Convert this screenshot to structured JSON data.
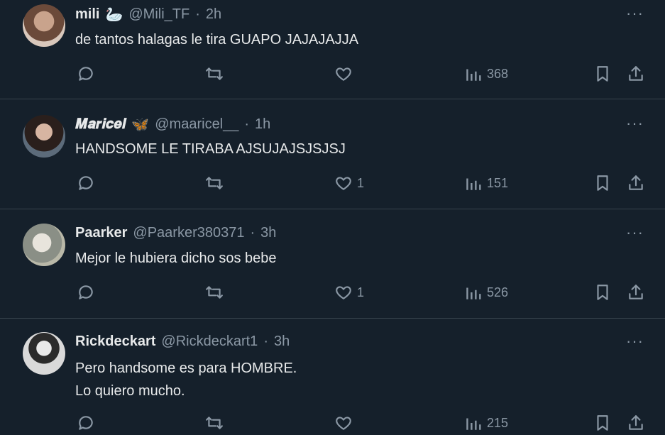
{
  "tweets": [
    {
      "name": "mili",
      "name_emoji": "🦢",
      "handle": "@Mili_TF",
      "time": "2h",
      "lines": [
        "de tantos halagas le tira GUAPO JAJAJAJJA"
      ],
      "likes": "",
      "views": "368"
    },
    {
      "name": "𝑴𝒂𝒓𝒊𝒄𝒆𝒍",
      "name_emoji": "🦋",
      "handle": "@maaricel__",
      "time": "1h",
      "lines": [
        "HANDSOME LE TIRABA AJSUJAJSJSJSJ"
      ],
      "likes": "1",
      "views": "151"
    },
    {
      "name": "Paarker",
      "name_emoji": "",
      "handle": "@Paarker380371",
      "time": "3h",
      "lines": [
        "Mejor le hubiera dicho sos bebe"
      ],
      "likes": "1",
      "views": "526"
    },
    {
      "name": "Rickdeckart",
      "name_emoji": "",
      "handle": "@Rickdeckart1",
      "time": "3h",
      "lines": [
        "Pero handsome es para HOMBRE.",
        "Lo quiero mucho."
      ],
      "likes": "",
      "views": "215"
    }
  ],
  "separator": "·",
  "more_glyph": "···",
  "icons": [
    "reply-icon",
    "retweet-icon",
    "like-icon",
    "views-icon",
    "bookmark-icon",
    "share-icon",
    "more-icon"
  ],
  "colors": {
    "background": "#15202b",
    "text": "#e7e9ea",
    "muted": "#8b98a5",
    "border": "#38444d"
  }
}
